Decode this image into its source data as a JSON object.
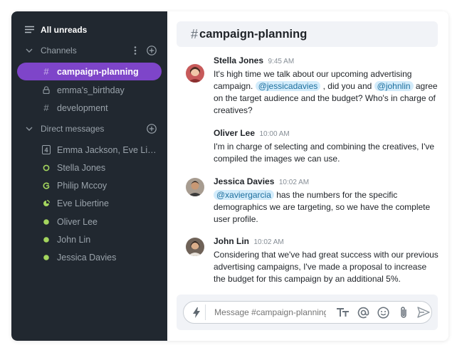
{
  "sidebar": {
    "all_unreads": "All unreads",
    "channels_label": "Channels",
    "channels": [
      {
        "label": "campaign-planning",
        "icon": "hash-icon",
        "active": true
      },
      {
        "label": "emma's_birthday",
        "icon": "lock-icon",
        "active": false
      },
      {
        "label": "development",
        "icon": "hash-icon",
        "active": false
      }
    ],
    "dm_label": "Direct messages",
    "direct_messages": [
      {
        "label": "Emma Jackson, Eve Libe...",
        "icon": "group-count-icon",
        "count": "4"
      },
      {
        "label": "Stella Jones",
        "icon": "status-away-icon"
      },
      {
        "label": "Philip Mccoy",
        "icon": "status-busy-icon"
      },
      {
        "label": "Eve Libertine",
        "icon": "status-dnd-icon"
      },
      {
        "label": "Oliver Lee",
        "icon": "status-online-icon"
      },
      {
        "label": "John Lin",
        "icon": "status-online-icon"
      },
      {
        "label": "Jessica Davies",
        "icon": "status-online-icon"
      }
    ]
  },
  "channel": {
    "hash": "#",
    "name": "campaign-planning"
  },
  "messages": [
    {
      "author": "Stella Jones",
      "time": "9:45 AM",
      "parts": [
        "It's high time we talk about our upcoming advertising campaign. ",
        {
          "mention": "@jessicadavies"
        },
        " , did you and ",
        {
          "mention": "@johnlin"
        },
        " agree on the target audience and the budget? Who's in charge of creatives?"
      ]
    },
    {
      "author": "Oliver Lee",
      "time": "10:00 AM",
      "parts": [
        "I'm in charge of selecting and combining the creatives, I've compiled the images we can use."
      ]
    },
    {
      "author": "Jessica Davies",
      "time": "10:02 AM",
      "parts": [
        {
          "mention": "@xaviergarcia"
        },
        " has the numbers for the specific demographics we are targeting, so we have the complete user profile."
      ]
    },
    {
      "author": "John Lin",
      "time": "10:02 AM",
      "parts": [
        "Considering that we've had great success with our previous advertising campaigns, I've made a proposal to increase the budget for this campaign by an additional 5%."
      ]
    }
  ],
  "composer": {
    "placeholder": "Message #campaign-planning"
  },
  "colors": {
    "sidebar_bg": "#212830",
    "active_channel": "#7e45c9",
    "status_online": "#a4d65e",
    "mention_bg": "#d3ecfb"
  }
}
